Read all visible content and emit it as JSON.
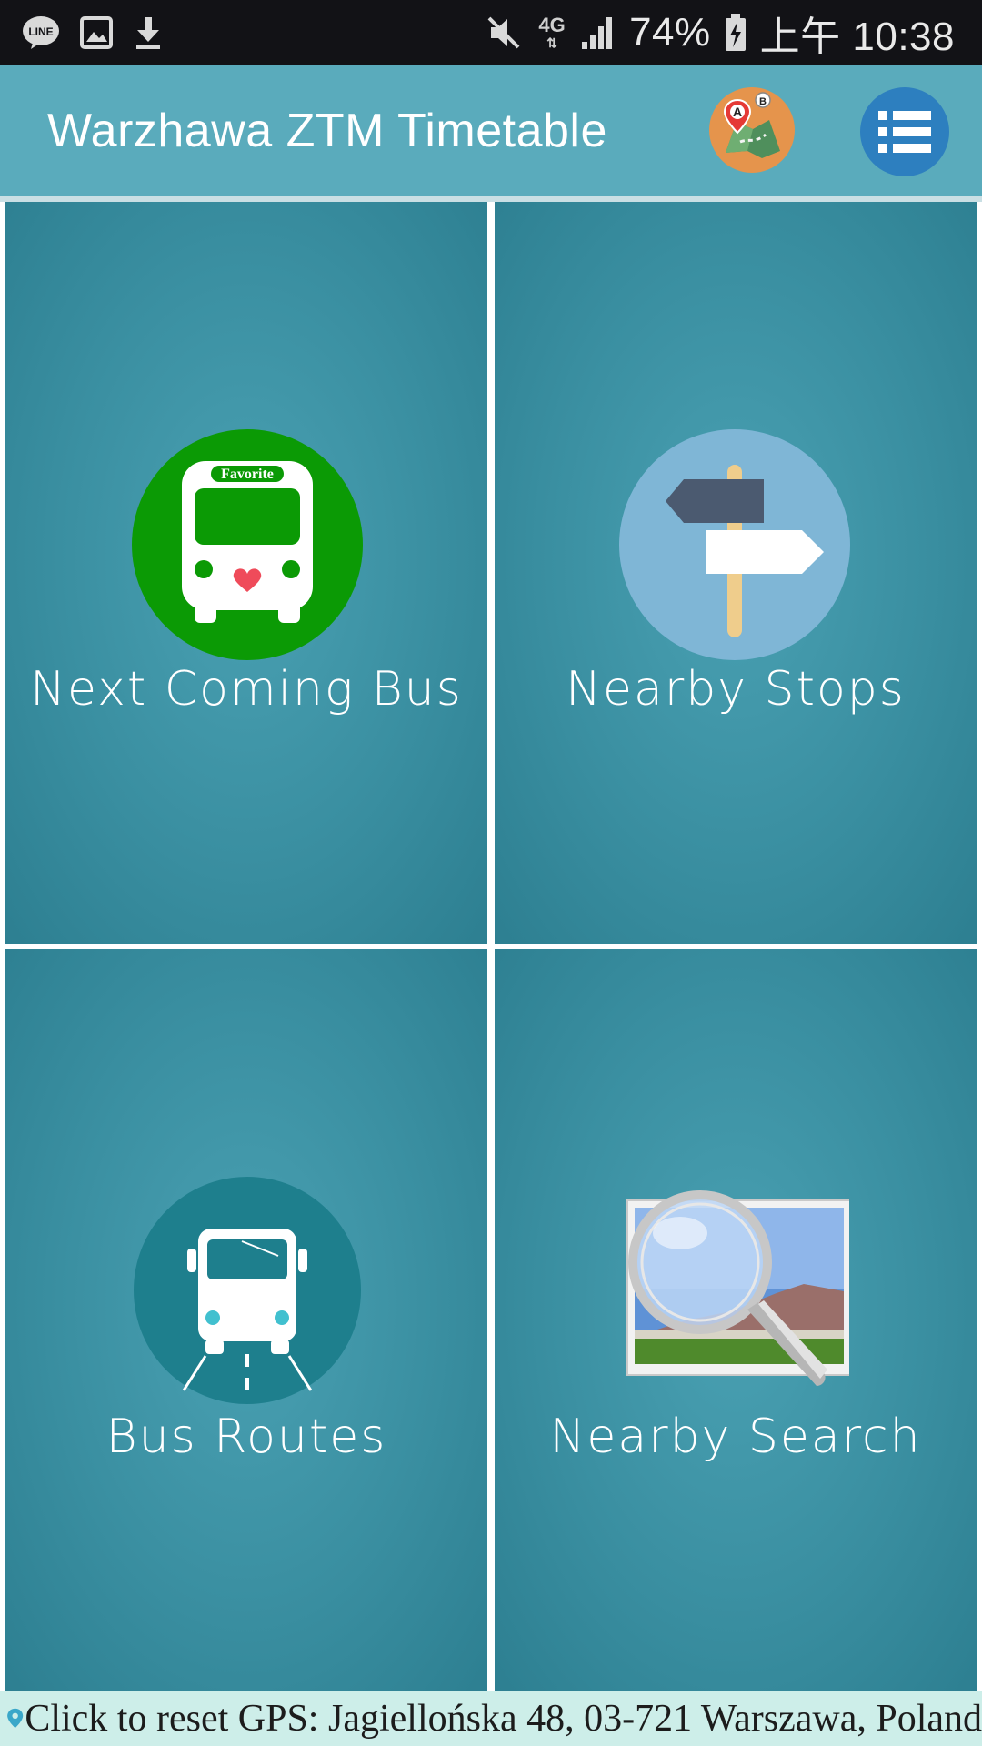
{
  "status_bar": {
    "left_icons": [
      "line-icon",
      "gallery-icon",
      "download-icon"
    ],
    "right_icons": [
      "mute-icon",
      "network-4g-icon",
      "signal-icon",
      "battery-charging-icon"
    ],
    "network": "4G",
    "battery": "74%",
    "time": "上午 10:38"
  },
  "app_bar": {
    "title": "Warzhawa ZTM Timetable",
    "buttons": [
      "map-route-icon",
      "list-menu-icon"
    ]
  },
  "tiles": [
    {
      "label": "Next Coming Bus",
      "icon": "favorite-bus-icon",
      "badge": "Favorite",
      "icon_bg": "#0b9a05"
    },
    {
      "label": "Nearby Stops",
      "icon": "signpost-icon",
      "icon_bg": "#7fb6d6"
    },
    {
      "label": "Bus Routes",
      "icon": "bus-route-icon",
      "icon_bg": "#1e7f8d"
    },
    {
      "label": "Nearby Search",
      "icon": "magnifier-photo-icon"
    }
  ],
  "gps_bar": {
    "icon": "location-pin-icon",
    "text": "Click to reset GPS: Jagiellońska 48, 03-721 Warszawa, Poland"
  },
  "colors": {
    "app_bar": "#5aabbc",
    "tile": "#3a8fa1",
    "gps_bar": "#cdeee9",
    "status_bar": "#121216"
  }
}
